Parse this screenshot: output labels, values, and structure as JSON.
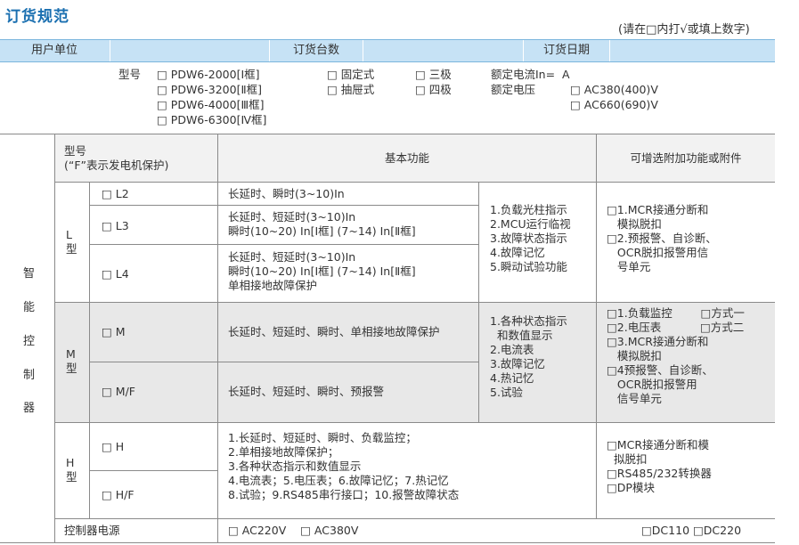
{
  "title": "订货规范",
  "note": "(请在□内打√或填上数字)",
  "header": {
    "user_unit": "用户单位",
    "order_qty": "订货台数",
    "order_date": "订货日期"
  },
  "options": {
    "model_label": "型号",
    "frames": [
      "□ PDW6-2000[Ⅰ框]",
      "□ PDW6-3200[Ⅱ框]",
      "□ PDW6-4000[Ⅲ框]",
      "□ PDW6-6300[Ⅳ框]"
    ],
    "install": [
      "□ 固定式",
      "□ 抽屉式"
    ],
    "poles": [
      "□ 三极",
      "□ 四极"
    ],
    "rated_current": "额定电流In=  A",
    "rated_voltage_label": "额定电压",
    "voltages": [
      "□ AC380(400)V",
      "□ AC660(690)V"
    ]
  },
  "table": {
    "col_model": "型号\n(“F”表示发电机保护)",
    "col_basic": "基本功能",
    "col_optional": "可增选附加功能或附件",
    "side_label": [
      "智",
      "能",
      "控",
      "制",
      "器"
    ],
    "L": {
      "type": "L\n型",
      "rows": [
        {
          "model": "□ L2",
          "basic": "长延时、瞬时(3~10)In"
        },
        {
          "model": "□ L3",
          "basic": "长延时、短延时(3~10)In\n瞬时(10~20) In[Ⅰ框] (7~14) In[Ⅱ框]"
        },
        {
          "model": "□ L4",
          "basic": "长延时、短延时(3~10)In\n瞬时(10~20) In[Ⅰ框] (7~14) In[Ⅱ框]\n单相接地故障保护"
        }
      ],
      "features": "1.负载光柱指示\n2.MCU运行临视\n3.故障状态指示\n4.故障记忆\n5.瞬动试验功能",
      "optional": "□1.MCR接通分断和\n   模拟脱扣\n□2.预报警、自诊断、\n   OCR脱扣报警用信\n   号单元"
    },
    "M": {
      "type": "M\n型",
      "rows": [
        {
          "model": "□ M",
          "basic": "长延时、短延时、瞬时、单相接地故障保护"
        },
        {
          "model": "□ M/F",
          "basic": "长延时、短延时、瞬时、预报警"
        }
      ],
      "features": "1.各种状态指示\n  和数值显示\n2.电流表\n3.故障记忆\n4.热记忆\n5.试验",
      "optional": "□1.负载监控        □方式一\n□2.电压表           □方式二\n□3.MCR接通分断和\n   模拟脱扣\n□4预报警、自诊断、\n   OCR脱扣报警用\n   信号单元"
    },
    "H": {
      "type": "H\n型",
      "rows": [
        {
          "model": "□ H"
        },
        {
          "model": "□ H/F"
        }
      ],
      "basic": "1.长延时、短延时、瞬时、负载监控；\n2.单相接地故障保护；\n3.各种状态指示和数值显示\n4.电流表；5.电压表；6.故障记忆；7.热记忆\n8.试验；9.RS485串行接口；10.报警故障状态",
      "optional": "□MCR接通分断和模\n  拟脱扣\n□RS485/232转换器\n□DP模块"
    },
    "power": {
      "label": "控制器电源",
      "ac": "□ AC220V    □ AC380V",
      "dc": "□DC110 □DC220"
    }
  }
}
